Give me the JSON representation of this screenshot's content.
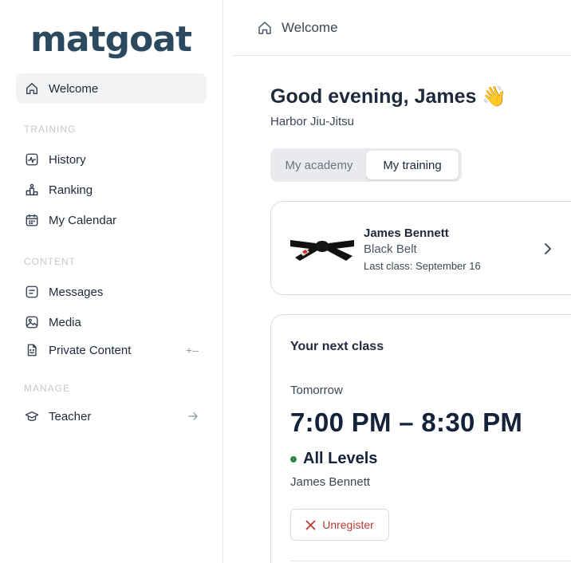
{
  "brand": {
    "logo_text": "matgoat",
    "logo_color": "#2b4a60"
  },
  "sidebar": {
    "items": [
      {
        "label": "Welcome",
        "icon": "home-icon",
        "active": true
      },
      {
        "label": "History",
        "icon": "activity-chart-icon"
      },
      {
        "label": "Ranking",
        "icon": "podium-icon"
      },
      {
        "label": "My Calendar",
        "icon": "calendar-icon"
      },
      {
        "label": "Messages",
        "icon": "message-icon"
      },
      {
        "label": "Media",
        "icon": "image-icon"
      },
      {
        "label": "Private Content",
        "icon": "private-content-icon",
        "trail": "+–"
      },
      {
        "label": "Teacher",
        "icon": "graduation-cap-icon",
        "trail_icon": "arrow-right-icon"
      }
    ],
    "sections": {
      "training": "TRAINING",
      "content": "CONTENT",
      "manage": "MANAGE"
    }
  },
  "header": {
    "breadcrumb": "Welcome",
    "breadcrumb_icon": "home-icon"
  },
  "main": {
    "greeting": "Good evening, James 👋",
    "academy": "Harbor Jiu-Jitsu",
    "tabs": [
      {
        "label": "My academy",
        "selected": false
      },
      {
        "label": "My training",
        "selected": true
      }
    ],
    "profile": {
      "name": "James Bennett",
      "rank": "Black Belt",
      "last_class": "Last class: September 16",
      "belt_icon": "black-belt-icon"
    },
    "next_class": {
      "title": "Your next class",
      "when": "Tomorrow",
      "time": "7:00 PM – 8:30 PM",
      "level": "All Levels",
      "level_color": "#2e8b4a",
      "instructor": "James Bennett",
      "unregister_label": "Unregister",
      "unregister_color": "#b73b30"
    }
  }
}
